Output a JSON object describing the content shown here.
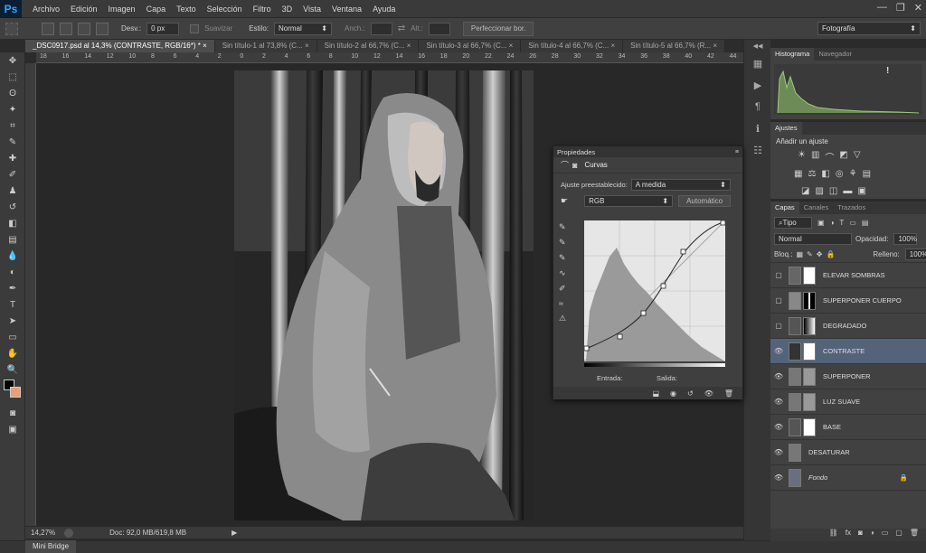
{
  "app": {
    "logo": "Ps",
    "window_controls": [
      "—",
      "❐",
      "✕"
    ]
  },
  "menu": [
    "Archivo",
    "Edición",
    "Imagen",
    "Capa",
    "Texto",
    "Selección",
    "Filtro",
    "3D",
    "Vista",
    "Ventana",
    "Ayuda"
  ],
  "options": {
    "desv_label": "Desv.:",
    "desv_value": "0 px",
    "suavizar": "Suavizar",
    "estilo_label": "Estilo:",
    "estilo_value": "Normal",
    "anch_label": "Anch.:",
    "alt_label": "Alt.:",
    "refine_button": "Perfeccionar bor.",
    "workspace": "Fotografía"
  },
  "tabs": [
    {
      "label": "_DSC0917.psd al 14,3% (CONTRASTE, RGB/16*) *",
      "close": "×"
    },
    {
      "label": "Sin título-1 al 73,8% (C...",
      "close": "×"
    },
    {
      "label": "Sin título-2 al 66,7% (C...",
      "close": "×"
    },
    {
      "label": "Sin título-3 al 66,7% (C...",
      "close": "×"
    },
    {
      "label": "Sin título-4 al 66,7% (C...",
      "close": "×"
    },
    {
      "label": "Sin título-5 al 66,7% (R...",
      "close": "×"
    }
  ],
  "ruler_h": [
    "18",
    "16",
    "14",
    "12",
    "10",
    "8",
    "6",
    "4",
    "2",
    "0",
    "2",
    "4",
    "6",
    "8",
    "10",
    "12",
    "14",
    "16",
    "18",
    "20",
    "22",
    "24",
    "26",
    "28",
    "30",
    "32",
    "34",
    "36",
    "38",
    "40",
    "42",
    "44"
  ],
  "status": {
    "zoom": "14,27%",
    "doc": "Doc: 92,0 MB/619,8 MB"
  },
  "minibridge": "Mini Bridge",
  "histogram": {
    "tabs": [
      "Histograma",
      "Navegador"
    ],
    "warning": "!"
  },
  "ajustes": {
    "tab": "Ajustes",
    "title": "Añadir un ajuste"
  },
  "properties": {
    "title": "Propiedades",
    "panel_title": "Curvas",
    "preset_label": "Ajuste preestablecido:",
    "preset_value": "A medida",
    "channel": "RGB",
    "auto_button": "Automático",
    "input_label": "Entrada:",
    "output_label": "Salida:"
  },
  "layers": {
    "tabs": [
      "Capas",
      "Canales",
      "Trazados"
    ],
    "filter": "Tipo",
    "blend": "Normal",
    "opacity_label": "Opacidad:",
    "opacity": "100%",
    "lock_label": "Bloq.:",
    "fill_label": "Relleno:",
    "fill": "100%",
    "items": [
      {
        "name": "ELEVAR SOMBRAS",
        "visible": false
      },
      {
        "name": "SUPERPONER CUERPO",
        "visible": false
      },
      {
        "name": "DEGRADADO",
        "visible": false
      },
      {
        "name": "CONTRASTE",
        "visible": true,
        "selected": true
      },
      {
        "name": "SUPERPONER",
        "visible": true
      },
      {
        "name": "LUZ SUAVE",
        "visible": true
      },
      {
        "name": "BASE",
        "visible": true
      },
      {
        "name": "DESATURAR",
        "visible": true
      },
      {
        "name": "Fondo",
        "visible": true,
        "italic": true
      }
    ]
  }
}
